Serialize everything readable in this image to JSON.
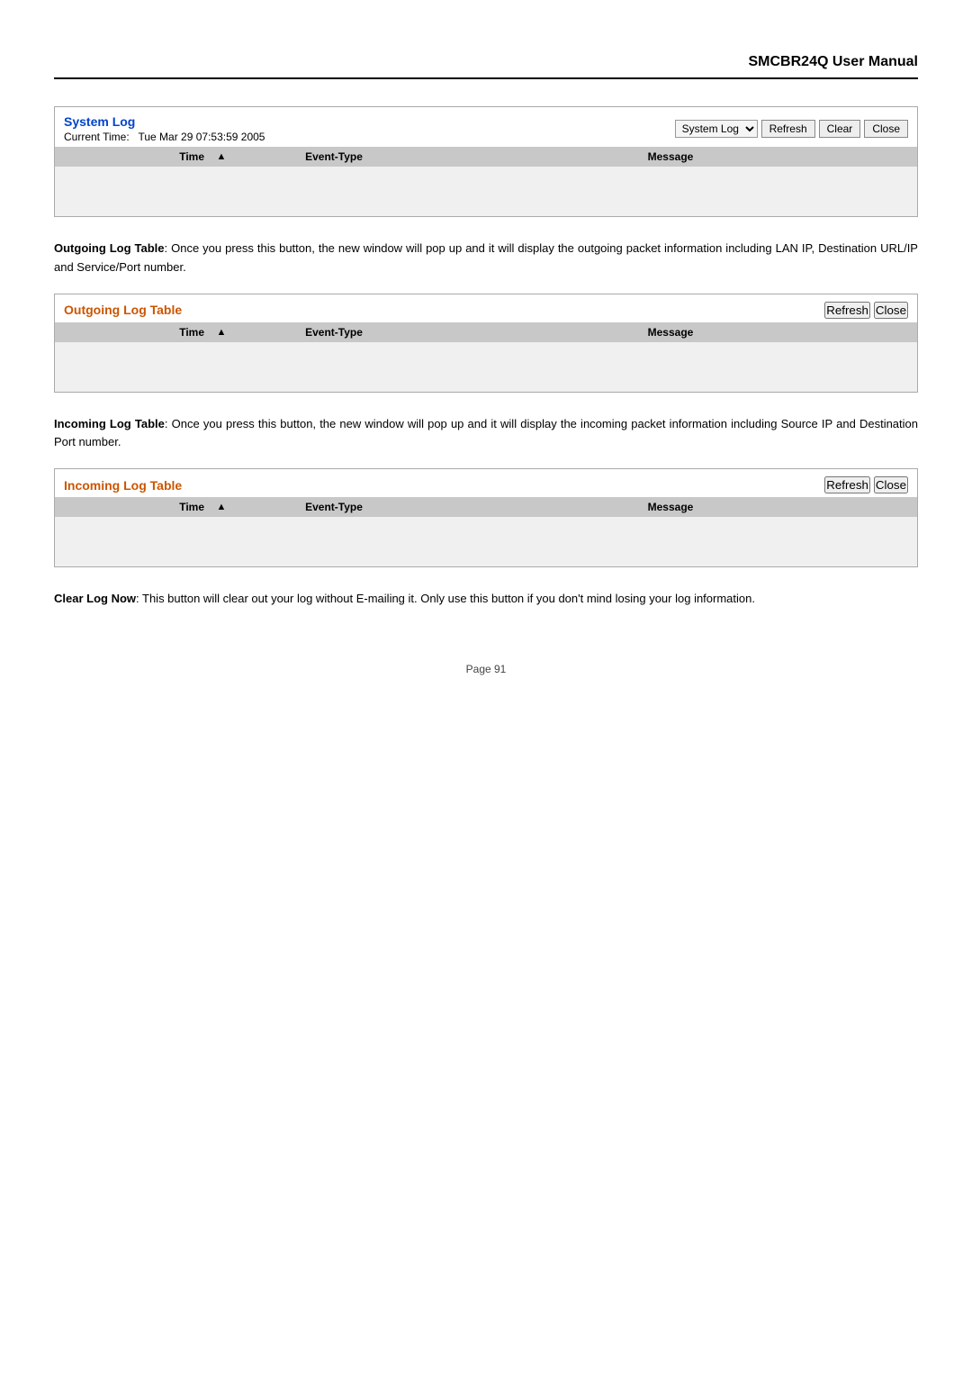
{
  "header": {
    "title": "SMCBR24Q User Manual"
  },
  "system_log_panel": {
    "title": "System Log",
    "current_time_label": "Current Time:",
    "current_time_value": "Tue Mar 29 07:53:59 2005",
    "dropdown_options": [
      "System Log"
    ],
    "dropdown_selected": "System Log",
    "refresh_label": "Refresh",
    "clear_label": "Clear",
    "close_label": "Close",
    "col_time": "Time",
    "col_sort_indicator": "▲",
    "col_event": "Event-Type",
    "col_message": "Message"
  },
  "outgoing_description": {
    "bold_term": "Outgoing Log Table",
    "text": ": Once you press this button, the new window will pop up and it will display the outgoing packet information including LAN IP, Destination URL/IP and Service/Port number."
  },
  "outgoing_log_panel": {
    "title": "Outgoing Log Table",
    "refresh_label": "Refresh",
    "close_label": "Close",
    "col_time": "Time",
    "col_sort_indicator": "▲",
    "col_event": "Event-Type",
    "col_message": "Message"
  },
  "incoming_description": {
    "bold_term": "Incoming Log Table",
    "text": ": Once you press this button, the new window will pop up and it will display the incoming packet information including Source IP and Destination Port number."
  },
  "incoming_log_panel": {
    "title": "Incoming Log Table",
    "refresh_label": "Refresh",
    "close_label": "Close",
    "col_time": "Time",
    "col_sort_indicator": "▲",
    "col_event": "Event-Type",
    "col_message": "Message"
  },
  "clear_log_description": {
    "bold_term": "Clear Log Now",
    "text": ": This button will clear out your log without E-mailing it. Only use this button if you don't mind losing your log information."
  },
  "footer": {
    "page_label": "Page 91"
  }
}
